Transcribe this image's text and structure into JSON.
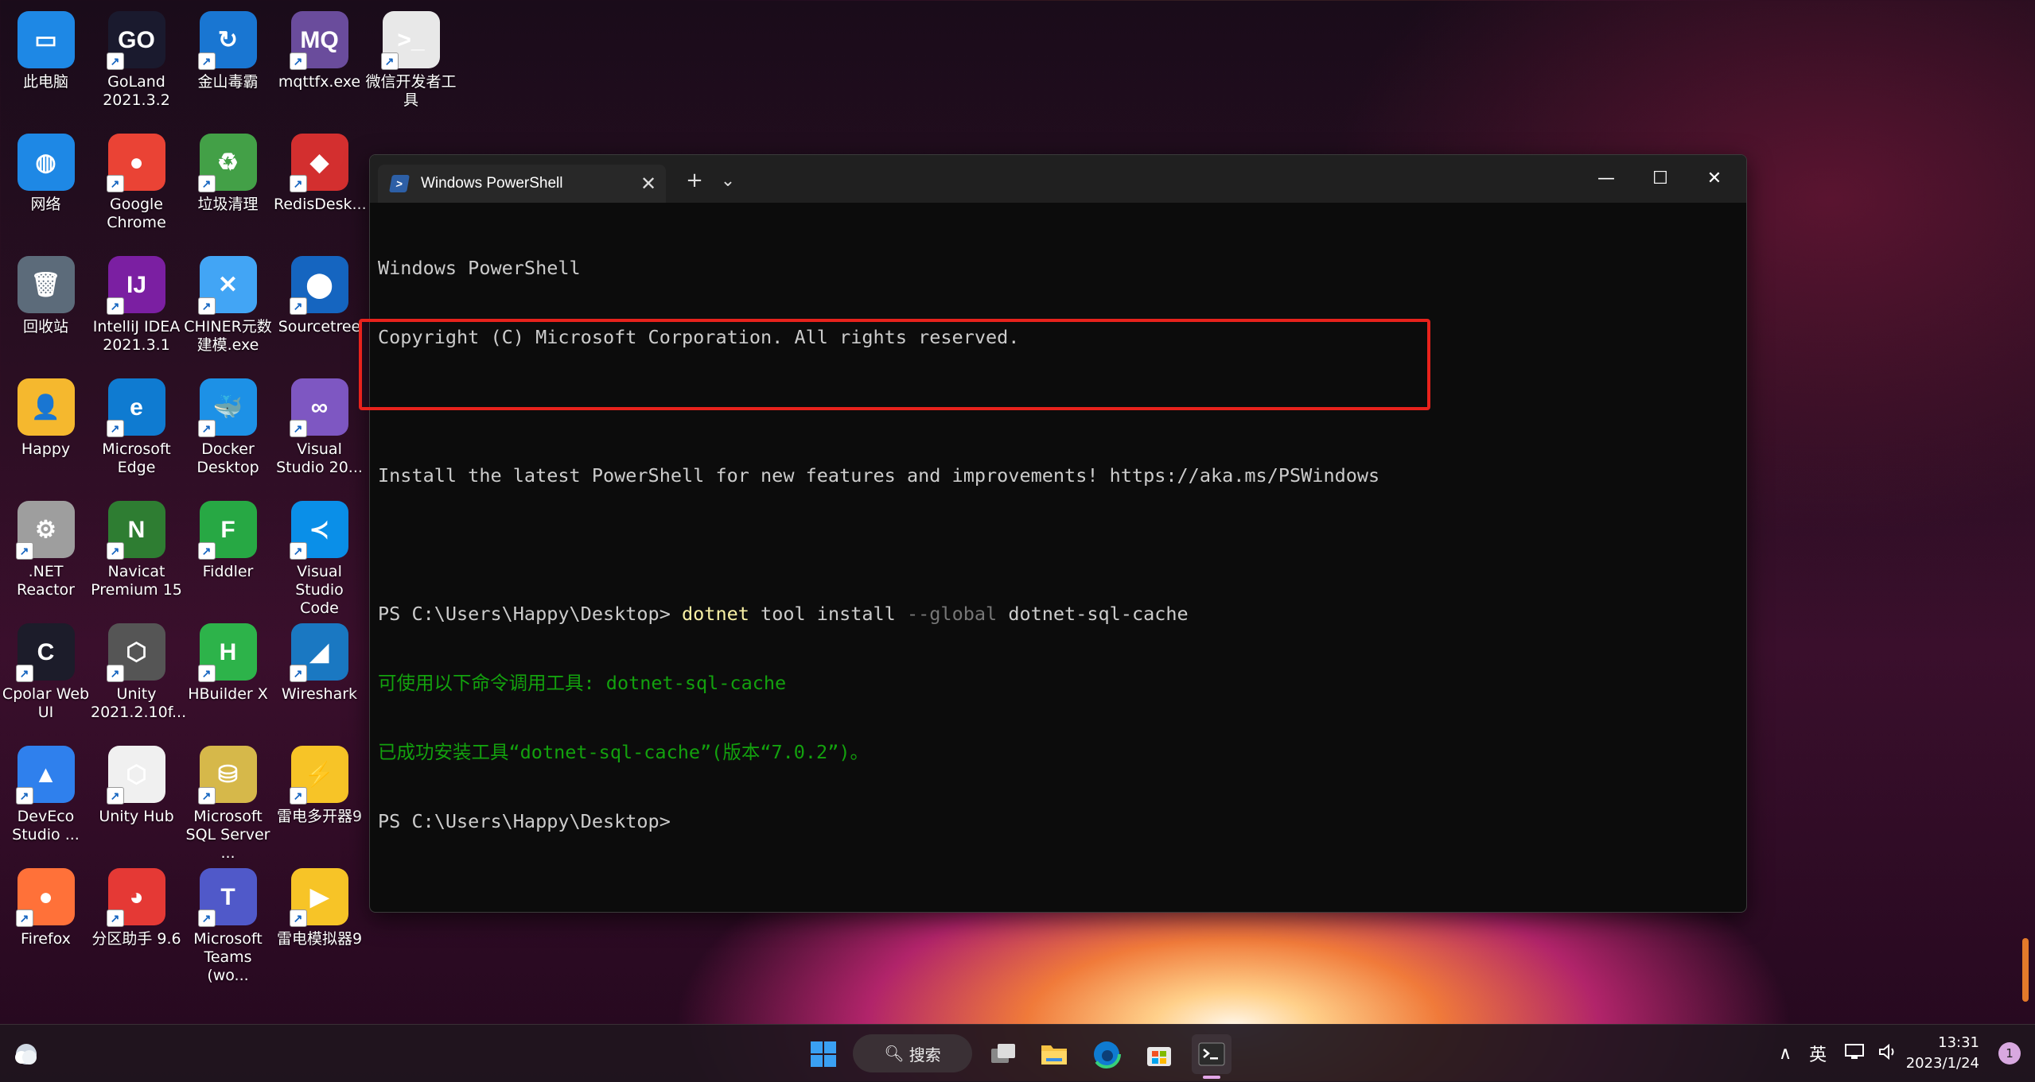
{
  "desktop": {
    "icons": [
      {
        "label": "此电脑",
        "glyph": "▭",
        "color": "#1e88e5"
      },
      {
        "label": "GoLand 2021.3.2",
        "glyph": "GO",
        "color": "#1a1a2e"
      },
      {
        "label": "金山毒霸",
        "glyph": "↻",
        "color": "#1976d2"
      },
      {
        "label": "mqttfx.exe",
        "glyph": "MQ",
        "color": "#6a4c9c"
      },
      {
        "label": "微信开发者工具",
        "glyph": ">_",
        "color": "#e8e8e8"
      },
      {
        "label": "网络",
        "glyph": "◍",
        "color": "#1e88e5"
      },
      {
        "label": "Google Chrome",
        "glyph": "●",
        "color": "#ea4335"
      },
      {
        "label": "垃圾清理",
        "glyph": "♻",
        "color": "#43a047"
      },
      {
        "label": "RedisDesk...",
        "glyph": "◆",
        "color": "#d32f2f"
      },
      {
        "label": "回收站",
        "glyph": "🗑",
        "color": "#5c6b7a"
      },
      {
        "label": "IntelliJ IDEA 2021.3.1",
        "glyph": "IJ",
        "color": "#7b1fa2"
      },
      {
        "label": "CHINER元数建模.exe",
        "glyph": "✕",
        "color": "#42a5f5"
      },
      {
        "label": "Sourcetree",
        "glyph": "⬤",
        "color": "#1565c0"
      },
      {
        "label": "Happy",
        "glyph": "👤",
        "color": "#f5b82e"
      },
      {
        "label": "Microsoft Edge",
        "glyph": "e",
        "color": "#0f7bd1"
      },
      {
        "label": "Docker Desktop",
        "glyph": "🐳",
        "color": "#1d91e6"
      },
      {
        "label": "Visual Studio 20...",
        "glyph": "∞",
        "color": "#7e57c2"
      },
      {
        "label": ".NET Reactor",
        "glyph": "⚙",
        "color": "#9e9e9e"
      },
      {
        "label": "Navicat Premium 15",
        "glyph": "N",
        "color": "#2e7d32"
      },
      {
        "label": "Fiddler",
        "glyph": "F",
        "color": "#27a844"
      },
      {
        "label": "Visual Studio Code",
        "glyph": "≺",
        "color": "#0a8fe8"
      },
      {
        "label": "Cpolar Web UI",
        "glyph": "C",
        "color": "#1c1c2a"
      },
      {
        "label": "Unity 2021.2.10f...",
        "glyph": "⬡",
        "color": "#555555"
      },
      {
        "label": "HBuilder X",
        "glyph": "H",
        "color": "#2db34a"
      },
      {
        "label": "Wireshark",
        "glyph": "◢",
        "color": "#1a78c2"
      },
      {
        "label": "DevEco Studio ...",
        "glyph": "▲",
        "color": "#2f80ed"
      },
      {
        "label": "Unity Hub",
        "glyph": "⬡",
        "color": "#f0f0f0"
      },
      {
        "label": "Microsoft SQL Server ...",
        "glyph": "⛁",
        "color": "#d6b84a"
      },
      {
        "label": "雷电多开器9",
        "glyph": "⚡",
        "color": "#f7c427"
      },
      {
        "label": "Firefox",
        "glyph": "●",
        "color": "#ff7139"
      },
      {
        "label": "分区助手 9.6",
        "glyph": "◕",
        "color": "#e53935"
      },
      {
        "label": "Microsoft Teams (wo...",
        "glyph": "T",
        "color": "#5059c9"
      },
      {
        "label": "雷电模拟器9",
        "glyph": "▶",
        "color": "#f7c427"
      }
    ]
  },
  "window": {
    "tab_title": "Windows PowerShell",
    "tab_close": "✕",
    "new_tab": "+",
    "dropdown": "⌄",
    "minimize": "—",
    "maximize": "☐",
    "close": "✕"
  },
  "terminal": {
    "line1": "Windows PowerShell",
    "line2": "Copyright (C) Microsoft Corporation. All rights reserved.",
    "line3": "",
    "line4": "Install the latest PowerShell for new features and improvements! https://aka.ms/PSWindows",
    "line5": "",
    "prompt1": "PS C:\\Users\\Happy\\Desktop> ",
    "cmd_name": "dotnet",
    "cmd_args1": " tool install ",
    "cmd_flag": "--global",
    "cmd_args2": " dotnet-sql-cache",
    "out1": "可使用以下命令调用工具: dotnet-sql-cache",
    "out2": "已成功安装工具“dotnet-sql-cache”(版本“7.0.2”)。",
    "prompt2": "PS C:\\Users\\Happy\\Desktop>"
  },
  "taskbar": {
    "search_label": "搜索",
    "ime": "英",
    "time": "13:31",
    "date": "2023/1/24",
    "notification_count": "1"
  },
  "colors": {
    "accent_box": "#e8221c",
    "terminal_green": "#13a10e",
    "terminal_yellow": "#f9f1a5"
  }
}
